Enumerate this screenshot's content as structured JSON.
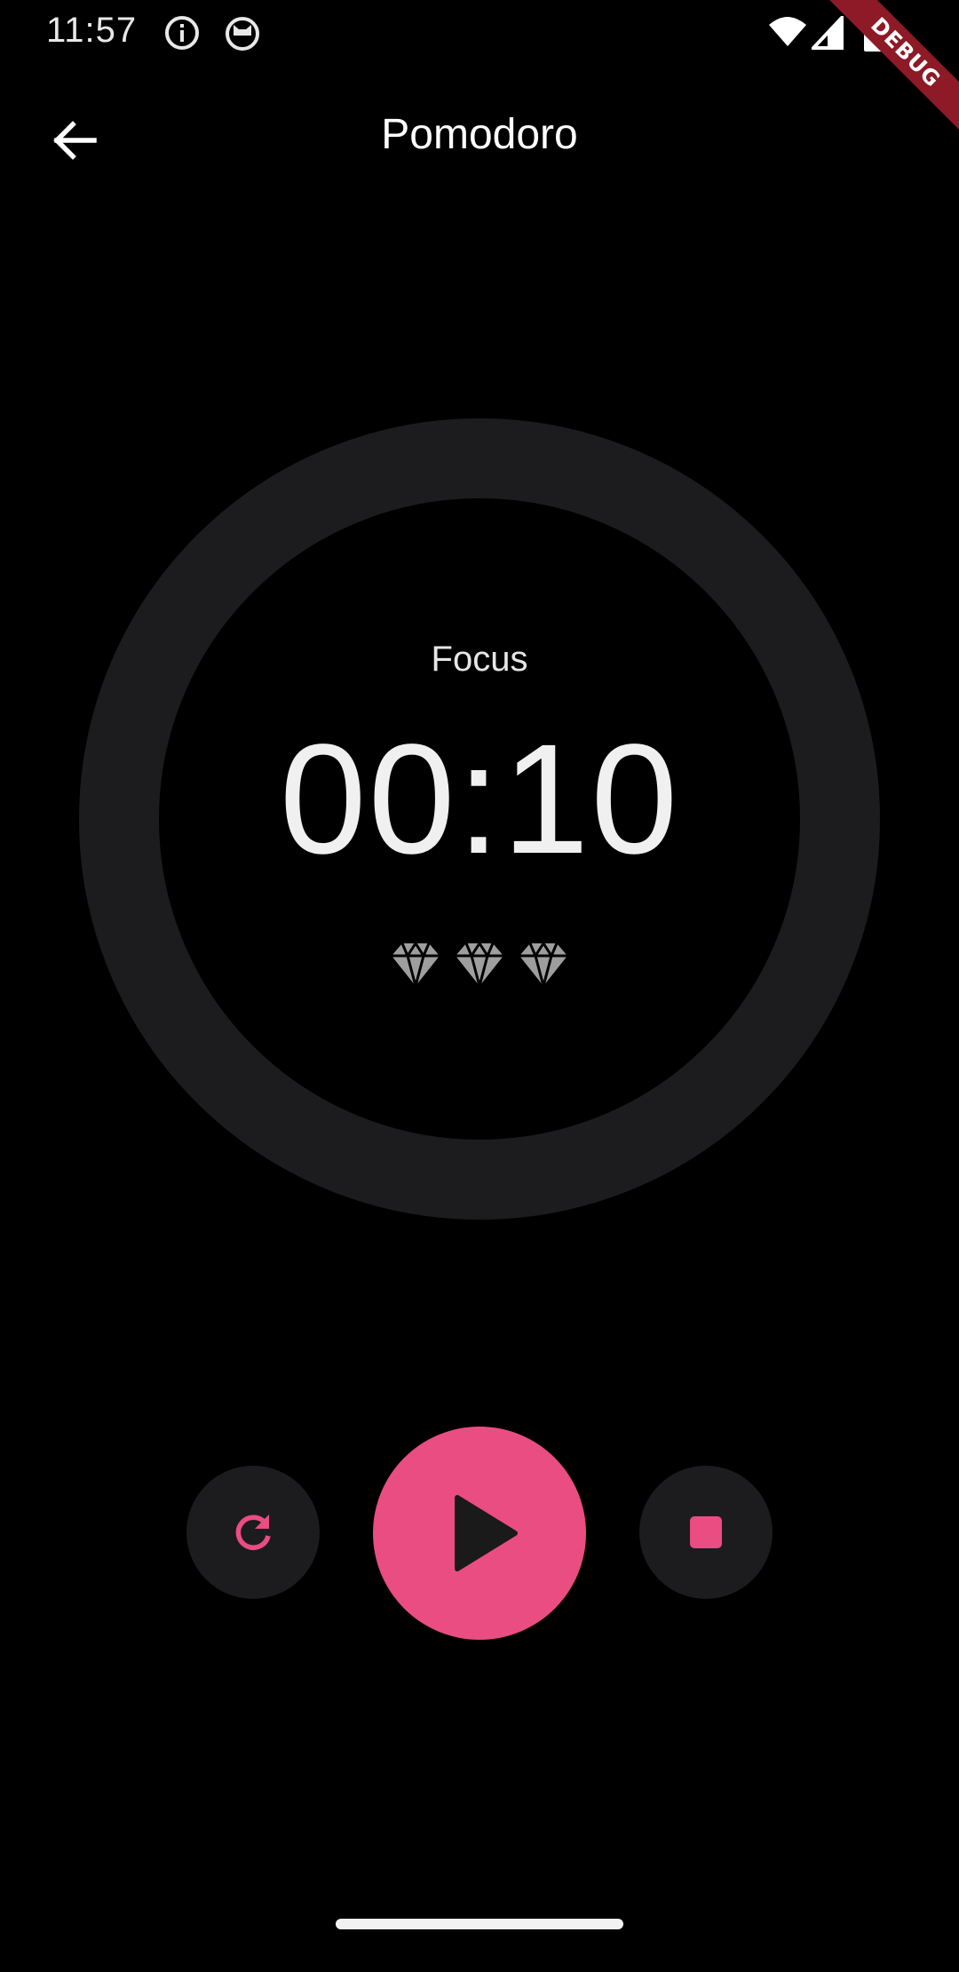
{
  "status_bar": {
    "time": "11:57",
    "icons": [
      "info-icon",
      "cat-icon",
      "wifi-icon",
      "signal-icon",
      "battery-icon"
    ]
  },
  "debug_banner": {
    "label": "DEBUG"
  },
  "app_bar": {
    "title": "Pomodoro",
    "back_icon": "arrow-back-icon"
  },
  "timer": {
    "phase": "Focus",
    "time": "00:10",
    "sessions_icon": "diamond-icon",
    "session_count": 3
  },
  "controls": {
    "reset_icon": "refresh-icon",
    "play_icon": "play-icon",
    "stop_icon": "stop-icon"
  },
  "colors": {
    "background": "#000000",
    "accent": "#e94d82",
    "ring": "#1c1c1e",
    "control_bg": "#1c1c1e",
    "text": "#ffffff",
    "gem": "#9e9e9e",
    "debug_ribbon": "#8d1a26"
  }
}
